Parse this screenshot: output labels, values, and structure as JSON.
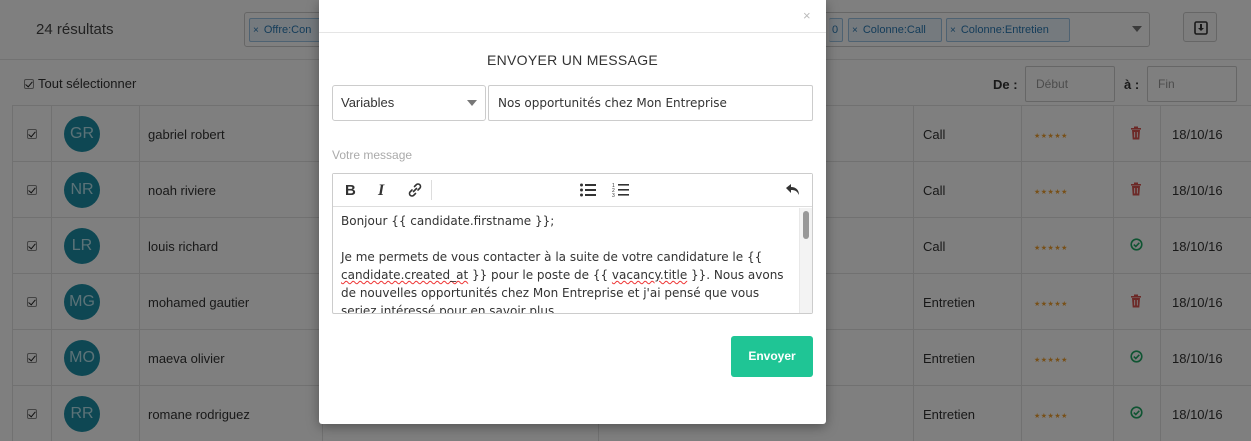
{
  "header": {
    "results_count": "24 résultats",
    "filter_tags": [
      {
        "label": "Offre:Con"
      },
      {
        "label": "0"
      },
      {
        "label": "Colonne:Call"
      },
      {
        "label": "Colonne:Entretien"
      }
    ],
    "export_icon": "export-icon"
  },
  "toolbar": {
    "select_all": "Tout sélectionner",
    "date_from_label": "De :",
    "date_from_placeholder": "Début",
    "date_to_label": "à :",
    "date_to_placeholder": "Fin"
  },
  "table": {
    "rows": [
      {
        "initials": "GR",
        "name": "gabriel robert",
        "status": "Call",
        "stars": "★★★★★",
        "action": "delete",
        "date": "18/10/16"
      },
      {
        "initials": "NR",
        "name": "noah riviere",
        "status": "Call",
        "stars": "★★★★★",
        "action": "delete",
        "date": "18/10/16"
      },
      {
        "initials": "LR",
        "name": "louis richard",
        "status": "Call",
        "stars": "★★★★★",
        "action": "validated",
        "date": "18/10/16"
      },
      {
        "initials": "MG",
        "name": "mohamed gautier",
        "status": "Entretien",
        "stars": "★★★★★",
        "action": "delete",
        "date": "18/10/16"
      },
      {
        "initials": "MO",
        "name": "maeva olivier",
        "status": "Entretien",
        "stars": "★★★★★",
        "action": "validated",
        "date": "18/10/16"
      },
      {
        "initials": "RR",
        "name": "romane rodriguez",
        "status": "Entretien",
        "stars": "★★★★★",
        "action": "validated",
        "date": "18/10/16"
      }
    ]
  },
  "modal": {
    "close": "×",
    "title": "ENVOYER UN MESSAGE",
    "variables_select": "Variables",
    "subject_value": "Nos opportunités chez Mon Entreprise",
    "message_label": "Votre message",
    "editor_tools": [
      "bold-icon",
      "italic-icon",
      "link-icon",
      "bullet-list-icon",
      "numbered-list-icon",
      "undo-icon"
    ],
    "body": {
      "line1": "Bonjour {{ candidate.firstname }};",
      "p2_a": "Je me permets de vous contacter à la suite de votre candidature le {{ ",
      "p2_b": "candidate.created_at",
      "p2_c": " }} pour le poste de  {{ ",
      "p2_d": "vacancy.title",
      "p2_e": " }}. Nous avons de nouvelles opportunités chez Mon Entreprise et j'ai pensé que vous seriez intéressé pour en savoir plus."
    },
    "send_button": "Envoyer"
  },
  "colors": {
    "avatar": "#1d8fa6",
    "send": "#1fc595",
    "delete": "#d9534f",
    "validated": "#1fa865",
    "stars": "#f0a030"
  }
}
